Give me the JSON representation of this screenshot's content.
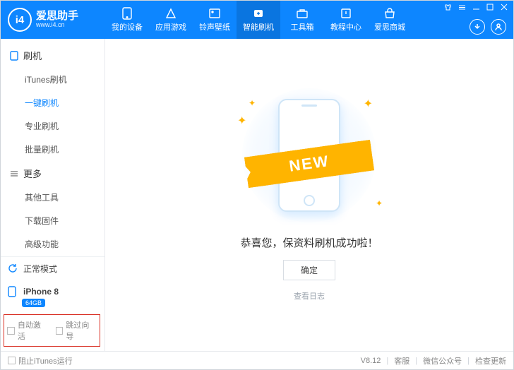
{
  "header": {
    "logo_initials": "i4",
    "brand": "爱思助手",
    "url": "www.i4.cn",
    "tabs": [
      {
        "id": "device",
        "label": "我的设备"
      },
      {
        "id": "apps",
        "label": "应用游戏"
      },
      {
        "id": "ring",
        "label": "铃声壁纸"
      },
      {
        "id": "flash",
        "label": "智能刷机",
        "active": true
      },
      {
        "id": "tools",
        "label": "工具箱"
      },
      {
        "id": "help",
        "label": "教程中心"
      },
      {
        "id": "mall",
        "label": "爱思商城"
      }
    ]
  },
  "sidebar": {
    "cats": [
      {
        "title": "刷机",
        "items": [
          {
            "label": "iTunes刷机"
          },
          {
            "label": "一键刷机",
            "active": true
          },
          {
            "label": "专业刷机"
          },
          {
            "label": "批量刷机"
          }
        ]
      },
      {
        "title": "更多",
        "items": [
          {
            "label": "其他工具"
          },
          {
            "label": "下载固件"
          },
          {
            "label": "高级功能"
          }
        ]
      }
    ],
    "mode": "正常模式",
    "device": "iPhone 8",
    "storage": "64GB",
    "checks": {
      "auto_activate": "自动激活",
      "skip_guide": "跳过向导"
    }
  },
  "content": {
    "ribbon": "NEW",
    "message": "恭喜您，保资料刷机成功啦！",
    "confirm": "确定",
    "log": "查看日志"
  },
  "footer": {
    "block_itunes": "阻止iTunes运行",
    "version": "V8.12",
    "links": {
      "kefu": "客服",
      "wechat": "微信公众号",
      "update": "检查更新"
    }
  }
}
